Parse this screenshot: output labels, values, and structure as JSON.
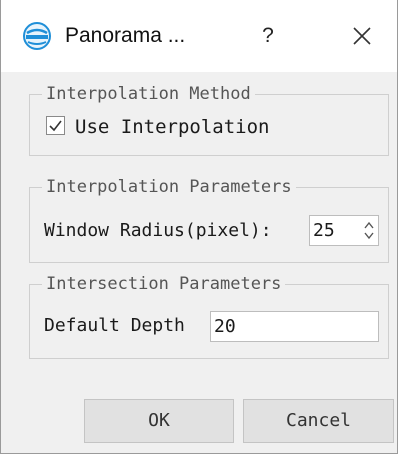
{
  "window": {
    "title": "Panorama ...",
    "help_label": "?",
    "close_label": "✕",
    "app_icon": "lifuser-logo-icon"
  },
  "interpolation_method": {
    "title": "Interpolation Method",
    "use_interpolation_label": "Use Interpolation",
    "use_interpolation_checked": true
  },
  "interpolation_parameters": {
    "title": "Interpolation Parameters",
    "window_radius_label": "Window Radius(pixel):",
    "window_radius_value": "25"
  },
  "intersection_parameters": {
    "title": "Intersection Parameters",
    "default_depth_label": "Default Depth",
    "default_depth_value": "20"
  },
  "buttons": {
    "ok_label": "OK",
    "cancel_label": "Cancel"
  },
  "colors": {
    "dialog_background": "#f0f0f0",
    "titlebar_background": "#ffffff",
    "button_background": "#e1e1e1",
    "app_icon_blue": "#1f8fd8"
  }
}
